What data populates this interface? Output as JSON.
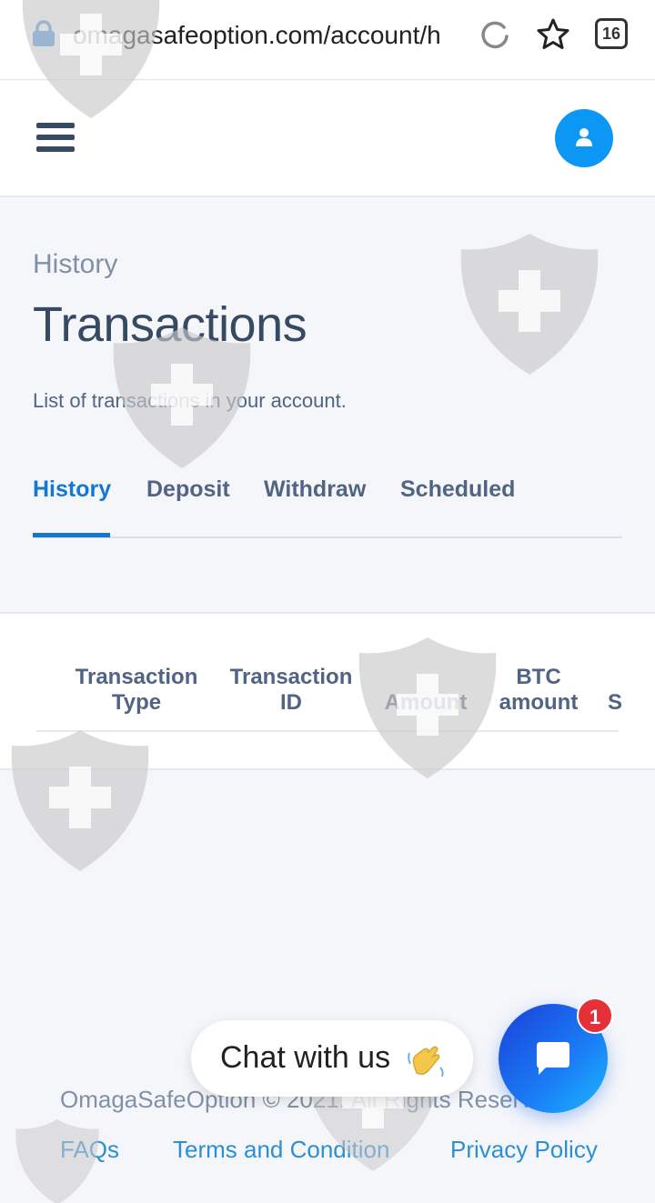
{
  "browser": {
    "url": "omagasafeoption.com/account/h",
    "tab_count": "16",
    "icons": [
      "lock-icon",
      "reload-icon",
      "star-icon"
    ]
  },
  "header": {
    "menu_icon": "hamburger-icon",
    "avatar_icon": "user-icon",
    "accent_color": "#0d97f5"
  },
  "page": {
    "overline": "History",
    "title": "Transactions",
    "description": "List of transactions in your account."
  },
  "tabs": [
    {
      "label": "History",
      "active": true
    },
    {
      "label": "Deposit",
      "active": false
    },
    {
      "label": "Withdraw",
      "active": false
    },
    {
      "label": "Scheduled",
      "active": false
    }
  ],
  "table": {
    "columns": [
      {
        "line1": "Transaction",
        "line2": "Type"
      },
      {
        "line1": "Transaction",
        "line2": "ID"
      },
      {
        "line1": "",
        "line2": "Amount"
      },
      {
        "line1": "BTC",
        "line2": "amount"
      },
      {
        "line1": "",
        "line2": "S"
      }
    ],
    "rows": []
  },
  "footer": {
    "copyright": "OmagaSafeOption © 2021. All Rights Reserved.",
    "links": [
      "FAQs",
      "Terms and Condition",
      "Privacy Policy"
    ]
  },
  "chat": {
    "label": "Chat with us",
    "unread": "1",
    "colors": {
      "button": "#1a7ef5",
      "badge": "#e5303a"
    }
  }
}
